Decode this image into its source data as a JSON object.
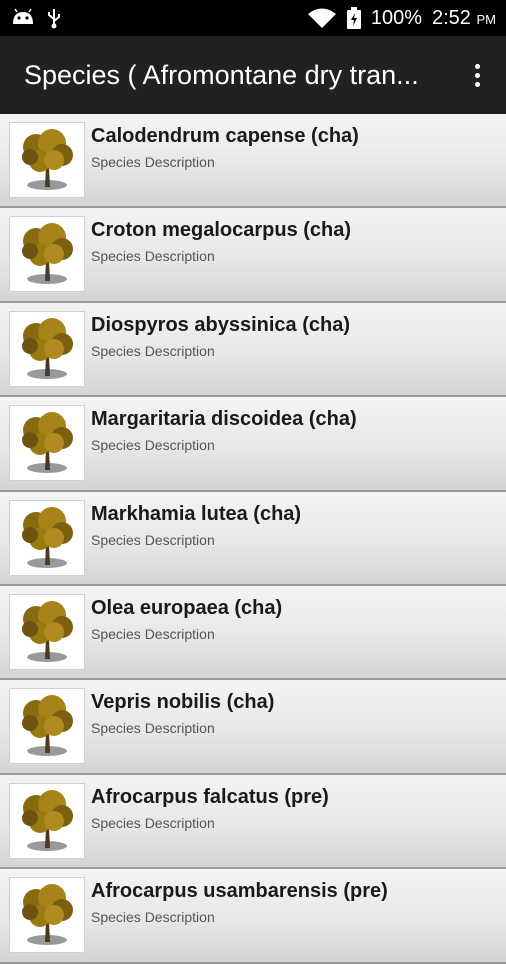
{
  "status_bar": {
    "battery": "100%",
    "time": "2:52",
    "ampm": "PM"
  },
  "app_bar": {
    "title": "Species ( Afromontane dry tran..."
  },
  "species": [
    {
      "name": "Calodendrum capense (cha)",
      "desc": "Species Description"
    },
    {
      "name": "Croton megalocarpus (cha)",
      "desc": "Species Description"
    },
    {
      "name": "Diospyros abyssinica (cha)",
      "desc": "Species Description"
    },
    {
      "name": "Margaritaria discoidea (cha)",
      "desc": "Species Description"
    },
    {
      "name": "Markhamia lutea (cha)",
      "desc": "Species Description"
    },
    {
      "name": "Olea europaea (cha)",
      "desc": "Species Description"
    },
    {
      "name": "Vepris nobilis (cha)",
      "desc": "Species Description"
    },
    {
      "name": "Afrocarpus falcatus (pre)",
      "desc": "Species Description"
    },
    {
      "name": "Afrocarpus usambarensis (pre)",
      "desc": "Species Description"
    }
  ],
  "colors": {
    "status_bar": "#000000",
    "app_bar": "#212121",
    "tree_foliage": "#9b7a12"
  },
  "icons": [
    "android-icon",
    "usb-icon",
    "wifi-icon",
    "battery-icon",
    "overflow-menu-icon",
    "tree-icon"
  ]
}
